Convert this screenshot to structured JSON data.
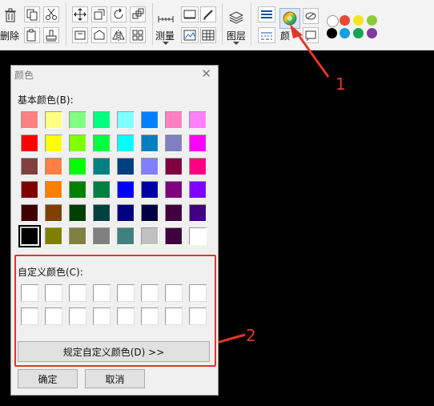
{
  "toolbar": {
    "delete_label": "删除",
    "measure_label": "测量",
    "layer_label": "图层",
    "color_label_part": "颜",
    "palette": [
      {
        "color": "#ffffff",
        "name": "white"
      },
      {
        "color": "#e8482f",
        "name": "red"
      },
      {
        "color": "#f3e51c",
        "name": "yellow"
      },
      {
        "color": "#8ccc3a",
        "name": "green"
      },
      {
        "color": "#000000",
        "name": "black"
      },
      {
        "color": "#14a0e2",
        "name": "blue"
      },
      {
        "color": "#12a650",
        "name": "dark-green"
      },
      {
        "color": "#7e3aa0",
        "name": "purple"
      }
    ]
  },
  "annotations": {
    "one": "1",
    "two": "2"
  },
  "dialog": {
    "title": "颜色",
    "close": "✕",
    "basic_label": "基本颜色(B):",
    "custom_label": "自定义颜色(C):",
    "define_button": "规定自定义颜色(D) >>",
    "ok_button": "确定",
    "cancel_button": "取消",
    "basic_colors": [
      [
        "#ff8080",
        "#ffff80",
        "#80ff80",
        "#00ff80",
        "#80ffff",
        "#0080ff",
        "#ff80c0",
        "#ff80ff"
      ],
      [
        "#ff0000",
        "#ffff00",
        "#80ff00",
        "#00ff40",
        "#00ffff",
        "#0080c0",
        "#8080c0",
        "#ff00ff"
      ],
      [
        "#804040",
        "#ff8040",
        "#00ff00",
        "#008080",
        "#004080",
        "#8080ff",
        "#800040",
        "#ff0080"
      ],
      [
        "#800000",
        "#ff8000",
        "#008000",
        "#008040",
        "#0000ff",
        "#0000a0",
        "#800080",
        "#8000ff"
      ],
      [
        "#400000",
        "#804000",
        "#004000",
        "#004040",
        "#000080",
        "#000040",
        "#400040",
        "#400080"
      ],
      [
        "#000000",
        "#808000",
        "#808040",
        "#808080",
        "#408080",
        "#c0c0c0",
        "#400040",
        "#ffffff"
      ]
    ],
    "selected": [
      5,
      0
    ]
  }
}
